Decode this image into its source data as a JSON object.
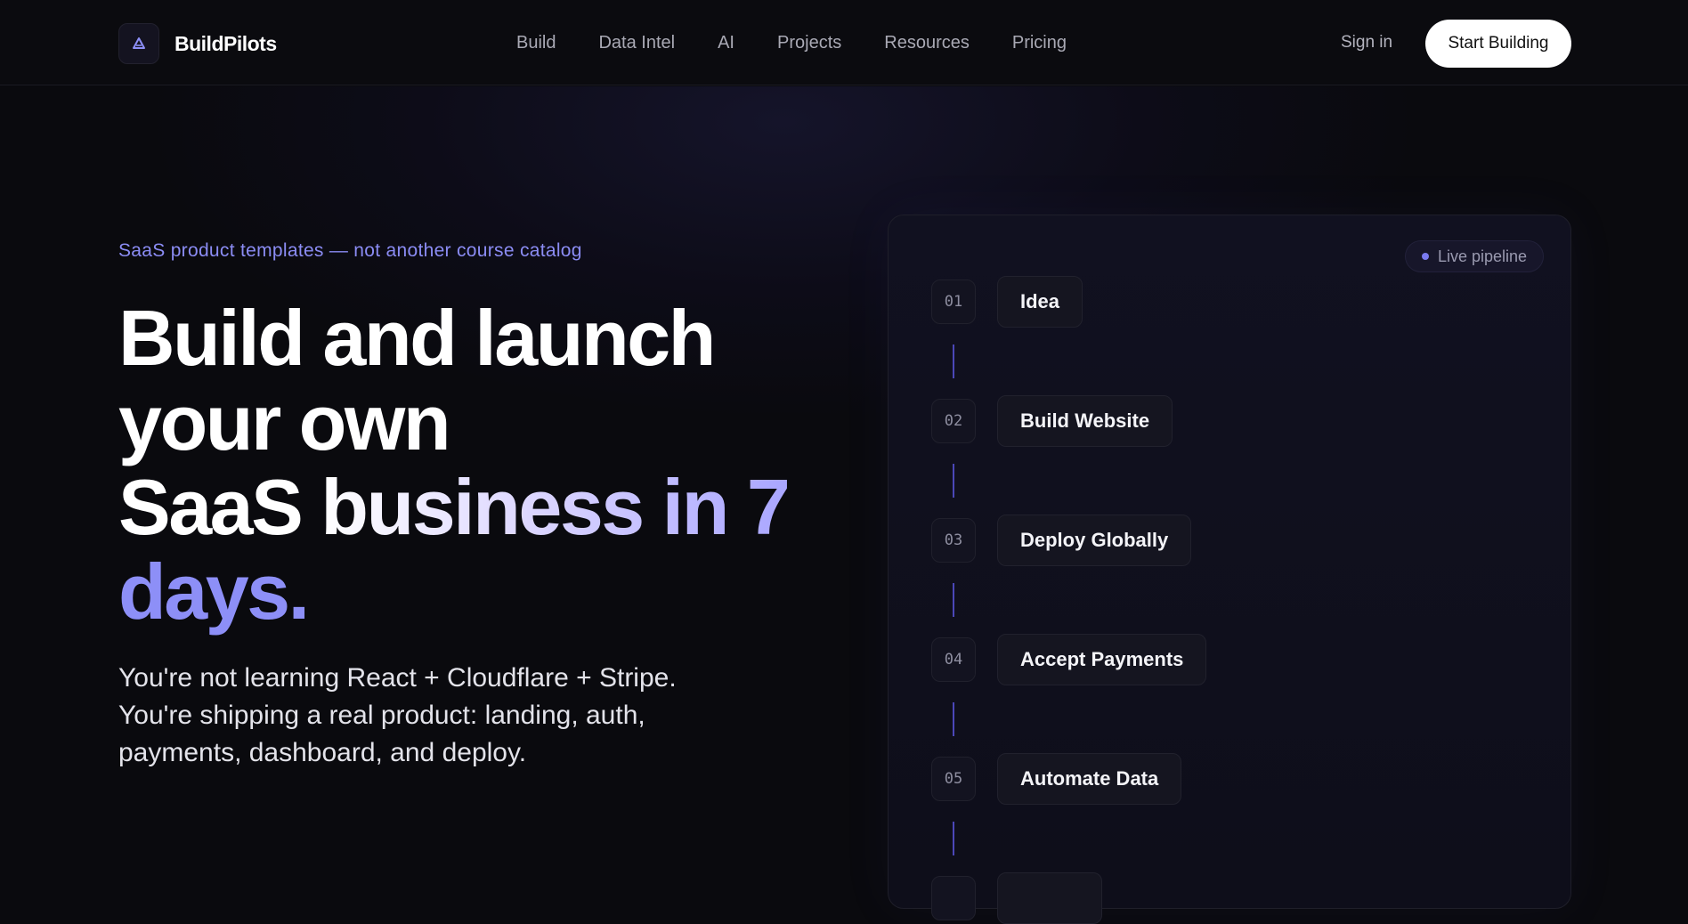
{
  "header": {
    "brand": "BuildPilots",
    "nav": [
      "Build",
      "Data Intel",
      "AI",
      "Projects",
      "Resources",
      "Pricing"
    ],
    "signin_label": "Sign in",
    "cta_label": "Start Building"
  },
  "hero": {
    "eyebrow": "SaaS product templates — not another course catalog",
    "headline": {
      "line1": "Build and launch",
      "line2": "your own",
      "line3_a": "SaaS",
      "line3_b": "business in 7",
      "line4": "days."
    },
    "sub": [
      "You're not learning React + Cloudflare + Stripe.",
      "You're shipping a real product: landing, auth,",
      "payments, dashboard, and deploy."
    ]
  },
  "pipeline": {
    "badge": "Live pipeline",
    "steps": [
      {
        "num": "01",
        "label": "Idea"
      },
      {
        "num": "02",
        "label": "Build Website"
      },
      {
        "num": "03",
        "label": "Deploy Globally"
      },
      {
        "num": "04",
        "label": "Accept Payments"
      },
      {
        "num": "05",
        "label": "Automate Data"
      }
    ]
  },
  "colors": {
    "accent": "#8b8cf4",
    "background": "#0a0a0e",
    "cta_bg": "#ffffff"
  },
  "icons": {
    "logo": "triangle-logo-icon",
    "live": "status-dot-icon"
  }
}
